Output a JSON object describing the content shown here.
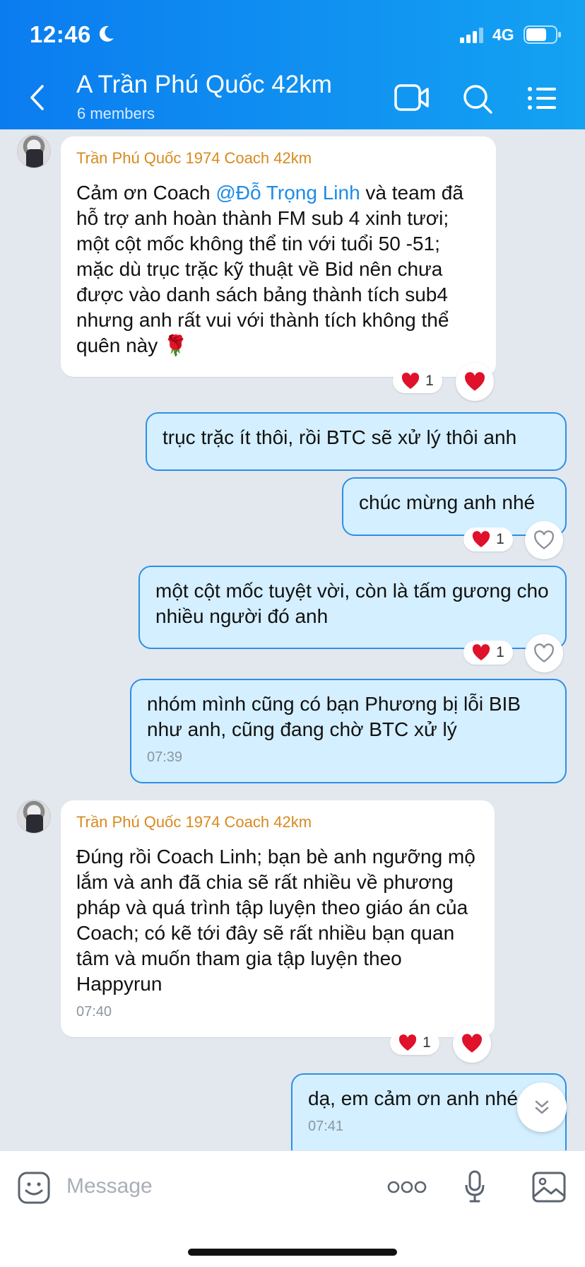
{
  "status_bar": {
    "time": "12:46",
    "network": "4G"
  },
  "header": {
    "title": "A Trần Phú Quốc 42km",
    "subtitle": "6 members"
  },
  "messages": [
    {
      "sender": "Trần Phú Quốc 1974 Coach 42km",
      "text_before": "Cảm ơn Coach ",
      "mention": "@Đỗ Trọng Linh",
      "text_after": "  và team đã hỗ trợ anh hoàn thành FM sub 4 xinh tươi; một cột mốc không thể tin với tuổi 50 -51; mặc dù trục trặc kỹ thuật về Bid nên chưa được vào danh sách bảng thành tích sub4 nhưng anh rất vui với thành tích không thể quên này",
      "emoji": "🌹",
      "reaction_count": "1"
    },
    {
      "text": "trục trặc ít thôi, rồi BTC sẽ xử lý thôi anh"
    },
    {
      "text": "chúc mừng anh nhé",
      "reaction_count": "1"
    },
    {
      "text": "một cột mốc tuyệt vời, còn là tấm gương cho nhiều người đó anh",
      "reaction_count": "1"
    },
    {
      "text": "nhóm mình cũng có bạn Phương bị lỗi BIB như anh, cũng đang chờ BTC xử lý",
      "time": "07:39"
    },
    {
      "sender": "Trần Phú Quốc 1974 Coach 42km",
      "text": "Đúng rồi Coach Linh; bạn bè anh ngưỡng mộ lắm và anh đã chia sẽ rất nhiều về phương pháp và quá trình tập luyện theo giáo án của Coach; có kẽ tới đây sẽ rất nhiều bạn quan tâm và muốn tham gia tập luyện theo Happyrun",
      "time": "07:40",
      "reaction_count": "1"
    },
    {
      "text": "dạ, em cảm ơn anh nhé",
      "time": "07:41"
    }
  ],
  "composer": {
    "placeholder": "Message"
  },
  "colors": {
    "header_start": "#0b7cf0",
    "header_end": "#14a2f2",
    "sender": "#d88a1d",
    "mention": "#1c8be8",
    "heart": "#e0112b",
    "outgoing_bubble": "#d4efff"
  }
}
